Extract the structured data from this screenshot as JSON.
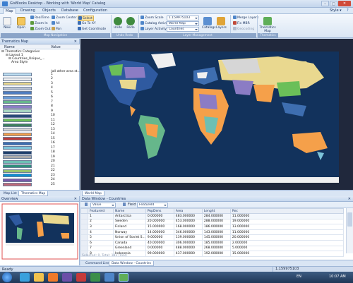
{
  "window": {
    "title": "GisBlocks Desktop - Working with 'World Map' Catalog"
  },
  "menu": {
    "items": [
      "Map",
      "Drawing",
      "Objects",
      "Database",
      "Configuration"
    ],
    "style_label": "Style ▾"
  },
  "ribbon": {
    "new": "New",
    "open": "Open",
    "realtime": "RealTime",
    "zoom_in": "Zoom In",
    "zoom_out": "Zoom Out",
    "zoom_center": "Zoom Center",
    "all": "All",
    "pan": "Pan",
    "select": "Select",
    "go_to_xy": "Go To XY",
    "get_coordinate": "Get Coordinate",
    "undo": "Undo",
    "redo": "Redo",
    "zoom_scale_label": "Zoom Scale",
    "zoom_scale_value": "1.159975103",
    "catalog_activity_label": "Catalog Activity",
    "catalog_activity_value": "World Map",
    "layer_activity_label": "Layer Activity",
    "layer_activity_value": "Countries",
    "catalogs": "Catalogs",
    "layers": "Layers",
    "merge_layers": "Merge Layers",
    "fix_mbr": "Fix MBR",
    "geocoding": "Geocoding",
    "thematics_map": "Thematics Map",
    "groups": [
      "Map Navigation",
      "Undo Redo",
      "Layer Management",
      "Thematics"
    ]
  },
  "left_panel": {
    "title": "Thematics Map",
    "col_name": "Name",
    "col_value": "Value",
    "tree": [
      "Thematics Categories",
      "Layout 1",
      "Countries_Unique_...",
      "Area Style"
    ],
    "all_other": "(all other area st...",
    "swatches": [
      {
        "color": "#bfe0f3",
        "label": "1"
      },
      {
        "color": "#f0f0f0",
        "label": "2"
      },
      {
        "color": "#e9d88f",
        "label": "3"
      },
      {
        "color": "#bcc5d3",
        "label": "4"
      },
      {
        "color": "#4f7dc0",
        "label": "5"
      },
      {
        "color": "#6a9bd6",
        "label": "6"
      },
      {
        "color": "#66b78b",
        "label": "7"
      },
      {
        "color": "#8b7cc4",
        "label": "8"
      },
      {
        "color": "#a7d6c2",
        "label": "9"
      },
      {
        "color": "#2a4a7a",
        "label": "10"
      },
      {
        "color": "#6bbf59",
        "label": "11"
      },
      {
        "color": "#3f7f5c",
        "label": "12"
      },
      {
        "color": "#d6d6d6",
        "label": "13"
      },
      {
        "color": "#f5a04a",
        "label": "14"
      },
      {
        "color": "#b83c3c",
        "label": "15"
      },
      {
        "color": "#3e6eb0",
        "label": "16"
      },
      {
        "color": "#7dc4d9",
        "label": "17"
      },
      {
        "color": "#1f3f6b",
        "label": "18"
      },
      {
        "color": "#a9a9a9",
        "label": "19"
      },
      {
        "color": "#6dbfb3",
        "label": "20"
      },
      {
        "color": "#2e8f7a",
        "label": "21"
      },
      {
        "color": "#98c36b",
        "label": "22"
      },
      {
        "color": "#0e8fd0",
        "label": "23"
      },
      {
        "color": "#7a5aa8",
        "label": "24"
      },
      {
        "color": "#c06a7a",
        "label": "25"
      }
    ],
    "tabs": [
      "Map List",
      "Thematics Map"
    ]
  },
  "map_tabs": [
    "World Map"
  ],
  "overview": {
    "title": "Overview"
  },
  "data_window": {
    "title": "Data Window - Countries",
    "toolbar": {
      "value_label": "Value",
      "field_label": "Field",
      "field_value": "FeatureId"
    },
    "columns": [
      "FeatureId",
      "Name",
      "PopDens",
      "Area",
      "Lenght",
      "Rec"
    ],
    "rows": [
      [
        "1",
        "Antarctica",
        "0.000000",
        "483.000000",
        "284.000000",
        "11.000000"
      ],
      [
        "2",
        "Sweden",
        "20.000000",
        "453.000000",
        "288.000000",
        "19.000000"
      ],
      [
        "3",
        "Finland",
        "15.000000",
        "168.000000",
        "186.000000",
        "13.000000"
      ],
      [
        "4",
        "Norway",
        "14.000000",
        "346.000000",
        "143.000000",
        "11.000000"
      ],
      [
        "5",
        "Union of Soviet S...",
        "9.000000",
        "139.000000",
        "145.000000",
        "20.000000"
      ],
      [
        "6",
        "Canada",
        "40.000000",
        "306.000000",
        "185.000000",
        "2.000000"
      ],
      [
        "7",
        "Greenland",
        "0.000000",
        "488.000000",
        "268.000000",
        "5.000000"
      ],
      [
        "8",
        "Indonesia",
        "99.000000",
        "437.000000",
        "192.000000",
        "15.000000"
      ]
    ],
    "footer": "Selected: 0, Total: 183 (183)",
    "tabs": [
      "Command Line",
      "Data Window - Countries"
    ]
  },
  "status": {
    "left": "Ready",
    "scale": "1.159975103"
  },
  "taskbar": {
    "lang": "EN",
    "time": "10:07 AM"
  }
}
